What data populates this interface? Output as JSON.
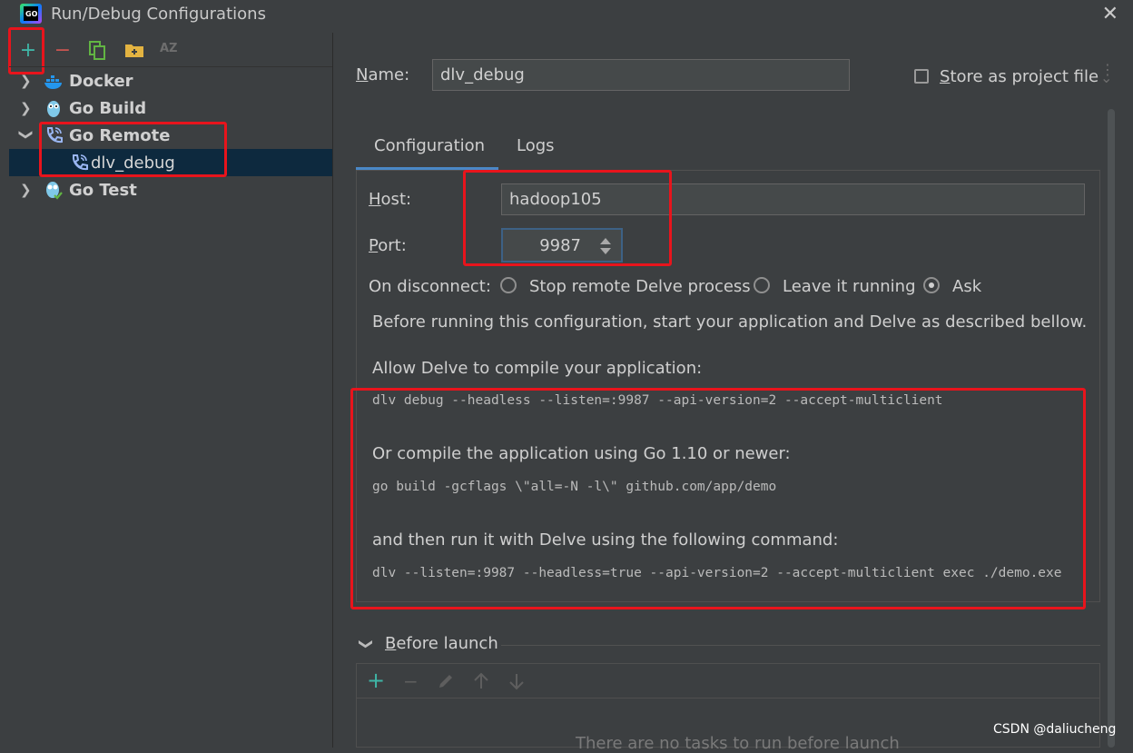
{
  "window": {
    "title": "Run/Debug Configurations",
    "close_glyph": "✕"
  },
  "toolbar": {
    "add_glyph": "+",
    "remove_glyph": "−",
    "sort_label": "AZ"
  },
  "tree": [
    {
      "label": "Docker",
      "expanded": false,
      "icon": "docker-icon"
    },
    {
      "label": "Go Build",
      "expanded": false,
      "icon": "gopher-icon"
    },
    {
      "label": "Go Remote",
      "expanded": true,
      "icon": "phone-icon"
    },
    {
      "label": "dlv_debug",
      "child": true,
      "selected": true,
      "icon": "phone-icon"
    },
    {
      "label": "Go Test",
      "expanded": false,
      "icon": "gopher-test-icon"
    }
  ],
  "name_field": {
    "label_first": "N",
    "label_rest": "ame:",
    "value": "dlv_debug"
  },
  "store_project": {
    "label_first": "S",
    "label_rest": "tore as project file",
    "checked": false
  },
  "tabs": [
    {
      "label": "Configuration",
      "active": true
    },
    {
      "label": "Logs",
      "active": false
    }
  ],
  "host": {
    "label_first": "H",
    "label_rest": "ost:",
    "value": "hadoop105"
  },
  "port": {
    "label_first": "P",
    "label_rest": "ort:",
    "value": "9987"
  },
  "disconnect": {
    "label": "On disconnect:",
    "options": [
      {
        "label": "Stop remote Delve process",
        "selected": false
      },
      {
        "label": "Leave it running",
        "selected": false
      },
      {
        "label": "Ask",
        "selected": true
      }
    ]
  },
  "instructions": {
    "intro": "Before running this configuration, start your application and Delve as described bellow.",
    "allow": "Allow Delve to compile your application:",
    "cmd1": "dlv debug --headless --listen=:9987 --api-version=2 --accept-multiclient",
    "compile": "Or compile the application using Go 1.10 or newer:",
    "cmd2": "go build -gcflags \\\"all=-N -l\\\" github.com/app/demo",
    "then_run": "and then run it with Delve using the following command:",
    "cmd3": "dlv --listen=:9987 --headless=true --api-version=2 --accept-multiclient exec ./demo.exe"
  },
  "before_launch": {
    "label_first": "B",
    "label_rest": "efore launch",
    "empty_text": "There are no tasks to run before launch"
  },
  "watermark": "CSDN @daliucheng",
  "colors": {
    "accent": "#4a88c7",
    "highlight_red": "#e8141c",
    "add_green": "#3fb5a6",
    "remove_red": "#c75450"
  }
}
